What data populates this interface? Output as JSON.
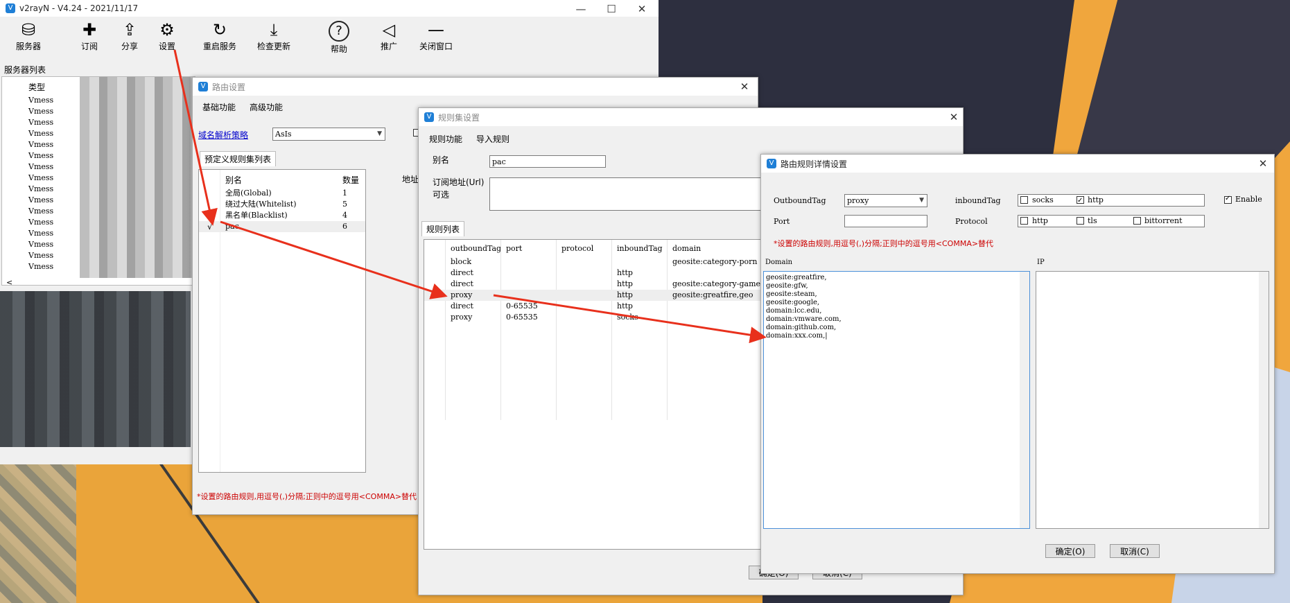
{
  "main": {
    "title": "v2rayN - V4.24 - 2021/11/17",
    "toolbar": [
      {
        "label": "服务器",
        "icon": "database-icon"
      },
      {
        "label": "订阅",
        "icon": "subscribe-icon"
      },
      {
        "label": "分享",
        "icon": "share-icon"
      },
      {
        "label": "设置",
        "icon": "gear-icon"
      },
      {
        "label": "重启服务",
        "icon": "restart-icon"
      },
      {
        "label": "检查更新",
        "icon": "download-icon"
      },
      {
        "label": "帮助",
        "icon": "help-icon"
      },
      {
        "label": "推广",
        "icon": "speaker-icon"
      },
      {
        "label": "关闭窗口",
        "icon": "minimize-line-icon"
      }
    ],
    "server_list_label": "服务器列表",
    "server_list_header": "类型",
    "server_rows": [
      "Vmess",
      "Vmess",
      "Vmess",
      "Vmess",
      "Vmess",
      "Vmess",
      "Vmess",
      "Vmess",
      "Vmess",
      "Vmess",
      "Vmess",
      "Vmess",
      "Vmess",
      "Vmess",
      "Vmess",
      "Vmess"
    ],
    "scroll_left": "<"
  },
  "routing": {
    "title": "路由设置",
    "tabs": [
      "基础功能",
      "高级功能"
    ],
    "domain_strategy_label": "域名解析策略",
    "domain_strategy_value": "AsIs",
    "ruleset_tab": "预定义规则集列表",
    "columns": [
      "别名",
      "数量",
      "地址"
    ],
    "rows": [
      {
        "alias": "全局(Global)",
        "count": "1"
      },
      {
        "alias": "绕过大陆(Whitelist)",
        "count": "5"
      },
      {
        "alias": "黑名单(Blacklist)",
        "count": "4"
      },
      {
        "alias": "pac",
        "count": "6",
        "checked": "√"
      }
    ],
    "note": "*设置的路由规则,用逗号(,)分隔;正则中的逗号用<COMMA>替代"
  },
  "ruleset": {
    "title": "规则集设置",
    "menus": [
      "规则功能",
      "导入规则"
    ],
    "alias_label": "别名",
    "alias_value": "pac",
    "sub_url_label": "订阅地址(Url)",
    "optional_label": "可选",
    "rules_tab": "规则列表",
    "columns": [
      "outboundTag",
      "port",
      "protocol",
      "inboundTag",
      "domain"
    ],
    "rows": [
      {
        "outbound": "block",
        "port": "",
        "protocol": "",
        "inbound": "",
        "domain": "geosite:category-porn"
      },
      {
        "outbound": "direct",
        "port": "",
        "protocol": "",
        "inbound": "http",
        "domain": ""
      },
      {
        "outbound": "direct",
        "port": "",
        "protocol": "",
        "inbound": "http",
        "domain": "geosite:category-game"
      },
      {
        "outbound": "proxy",
        "port": "",
        "protocol": "",
        "inbound": "http",
        "domain": "geosite:greatfire,geo"
      },
      {
        "outbound": "direct",
        "port": "0-65535",
        "protocol": "",
        "inbound": "http",
        "domain": ""
      },
      {
        "outbound": "proxy",
        "port": "0-65535",
        "protocol": "",
        "inbound": "socks",
        "domain": ""
      }
    ],
    "ok": "确定(O)",
    "cancel": "取消(C)"
  },
  "detail": {
    "title": "路由规则详情设置",
    "outbound_label": "OutboundTag",
    "outbound_value": "proxy",
    "inbound_label": "inboundTag",
    "inbound_options": [
      {
        "label": "socks",
        "checked": false
      },
      {
        "label": "http",
        "checked": true
      }
    ],
    "enable_label": "Enable",
    "enable_checked": true,
    "port_label": "Port",
    "port_value": "",
    "protocol_label": "Protocol",
    "protocol_options": [
      {
        "label": "http",
        "checked": false
      },
      {
        "label": "tls",
        "checked": false
      },
      {
        "label": "bittorrent",
        "checked": false
      }
    ],
    "note": "*设置的路由规则,用逗号(,)分隔;正则中的逗号用<COMMA>替代",
    "domain_label": "Domain",
    "ip_label": "IP",
    "domain_lines": [
      "geosite:greatfire,",
      "geosite:gfw,",
      "geosite:steam,",
      "geosite:google,",
      "domain:lcc.edu,",
      "domain:vmware.com,",
      "domain:github.com,",
      "domain:xxx.com,|"
    ],
    "ok": "确定(O)",
    "cancel": "取消(C)"
  },
  "colors": {
    "arrow": "#e8301c",
    "accent": "#1f7fd6",
    "note": "#cc0000"
  }
}
